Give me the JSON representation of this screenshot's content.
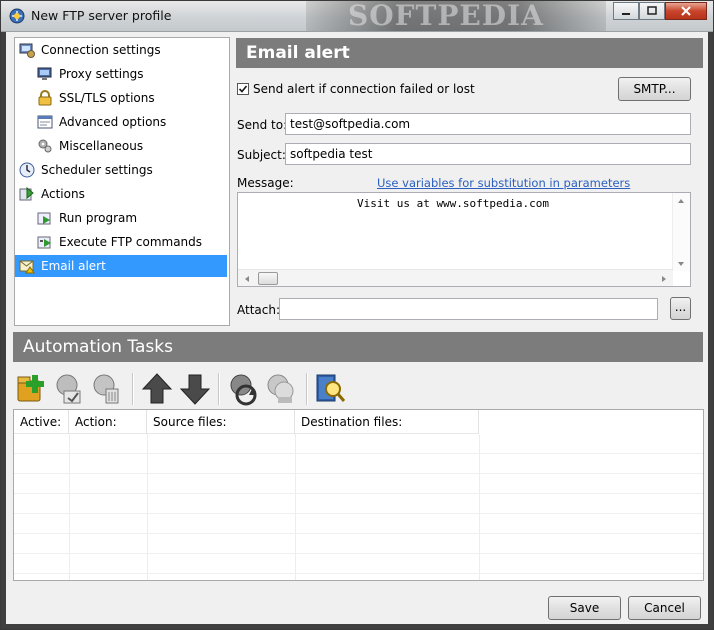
{
  "window": {
    "title": "New FTP server profile",
    "watermark": "SOFTPEDIA"
  },
  "tree": {
    "items": [
      {
        "label": "Connection settings",
        "icon": "computer-gear-icon",
        "level": 0
      },
      {
        "label": "Proxy settings",
        "icon": "monitor-network-icon",
        "level": 1
      },
      {
        "label": "SSL/TLS options",
        "icon": "padlock-icon",
        "level": 1
      },
      {
        "label": "Advanced options",
        "icon": "window-settings-icon",
        "level": 1
      },
      {
        "label": "Miscellaneous",
        "icon": "gears-icon",
        "level": 1
      },
      {
        "label": "Scheduler settings",
        "icon": "clock-icon",
        "level": 0
      },
      {
        "label": "Actions",
        "icon": "actions-icon",
        "level": 0
      },
      {
        "label": "Run program",
        "icon": "run-program-icon",
        "level": 1
      },
      {
        "label": "Execute FTP commands",
        "icon": "ftp-commands-icon",
        "level": 1
      },
      {
        "label": "Email alert",
        "icon": "email-alert-icon",
        "level": 0,
        "selected": true
      }
    ]
  },
  "email_alert": {
    "header": "Email alert",
    "send_alert_label": "Send alert if connection failed or lost",
    "send_alert_checked": true,
    "smtp_button": "SMTP...",
    "send_to_label": "Send to:",
    "send_to_value": "test@softpedia.com",
    "subject_label": "Subject:",
    "subject_value": "softpedia test",
    "message_label": "Message:",
    "variables_link": "Use variables for substitution in parameters",
    "message_value": "Visit us at www.softpedia.com",
    "attach_label": "Attach:",
    "attach_value": "",
    "browse_button": "..."
  },
  "tasks": {
    "header": "Automation Tasks",
    "toolbar": [
      {
        "icon": "add-task-icon"
      },
      {
        "icon": "edit-task-icon"
      },
      {
        "icon": "delete-task-icon"
      },
      {
        "icon": "move-up-icon"
      },
      {
        "icon": "move-down-icon"
      },
      {
        "icon": "run-task-icon"
      },
      {
        "icon": "clone-task-icon"
      },
      {
        "icon": "search-log-icon"
      }
    ],
    "columns": [
      "Active:",
      "Action:",
      "Source files:",
      "Destination files:"
    ]
  },
  "footer": {
    "save": "Save",
    "cancel": "Cancel"
  },
  "colors": {
    "selection": "#3399ff",
    "header_bg": "#7c7c7c",
    "link": "#2a5fbf"
  }
}
